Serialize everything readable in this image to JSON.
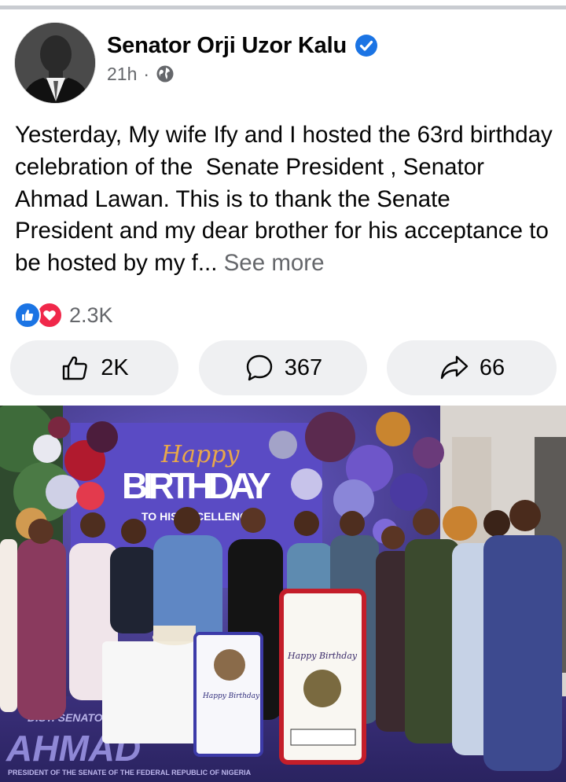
{
  "post": {
    "author_name": "Senator Orji Uzor Kalu",
    "time": "21h",
    "separator": "·",
    "text": "Yesterday, My wife Ify and I hosted the 63rd birthday celebration of the  Senate President , Senator  Ahmad Lawan. This is to thank the Senate President and my dear brother for his acceptance to be hosted by my f...",
    "see_more": " See more"
  },
  "reactions": {
    "count": "2.3K",
    "types": [
      "like-icon",
      "love-icon"
    ]
  },
  "actions": {
    "like_count": "2K",
    "comment_count": "367",
    "share_count": "66"
  },
  "photo": {
    "banner_script": "Happy",
    "banner_title": "BIRTHDAY",
    "banner_subtitle": "TO HIS EXCELLENCY",
    "frame_script": "Happy Birthday",
    "floor_text": "AHMAD",
    "floor_caption": "PRESIDENT OF THE SENATE OF THE FEDERAL REPUBLIC OF NIGERIA",
    "floor_small": "DIST. SENATOR"
  },
  "colors": {
    "accent": "#1b74e4",
    "love": "#f0284a",
    "secondary_text": "#65676b",
    "button_bg": "#eff0f2"
  }
}
